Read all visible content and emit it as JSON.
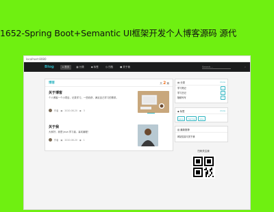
{
  "banner": {
    "text": "1652-Spring Boot+Semantic UI框架开发个人博客源码 源代"
  },
  "browser": {
    "url": "localhost:8080"
  },
  "navbar": {
    "brand": "Blog",
    "items": [
      "首页",
      "分类",
      "标签",
      "归档",
      "关于我"
    ],
    "search_placeholder": "Search..."
  },
  "main": {
    "title": "博客",
    "count_prefix": "共",
    "count": "2",
    "count_suffix": "篇",
    "posts": [
      {
        "title": "关于博客",
        "excerpt": "个人博客一个小项目，记录学习、一些收获，满足自己学习的需求。",
        "author": "作者",
        "date": "2020-08-20",
        "views": "3",
        "tag": "原创"
      },
      {
        "title": "关于我",
        "excerpt": "大家好，我是 Java 学习者，喜欢编程！",
        "author": "作者",
        "date": "2020-08-20",
        "views": "1",
        "tag": "原创"
      }
    ]
  },
  "sidebar": {
    "categories": {
      "title": "分类",
      "more": "more",
      "items": [
        {
          "name": "学习笔记",
          "count": "1"
        },
        {
          "name": "学习日记",
          "count": "1"
        },
        {
          "name": "随便写写",
          "count": "0"
        }
      ]
    },
    "tags": {
      "title": "标签",
      "more": "more",
      "items": [
        "Java",
        "Spring",
        "Vue"
      ]
    },
    "recommend": {
      "title": "最新推荐",
      "items": [
        "网站信息与关于我"
      ]
    }
  },
  "qr": {
    "label": "扫码关注我"
  },
  "colors": {
    "background": "#6ff011",
    "accent": "#2bb3c0",
    "navbar": "#1b1c1d"
  }
}
